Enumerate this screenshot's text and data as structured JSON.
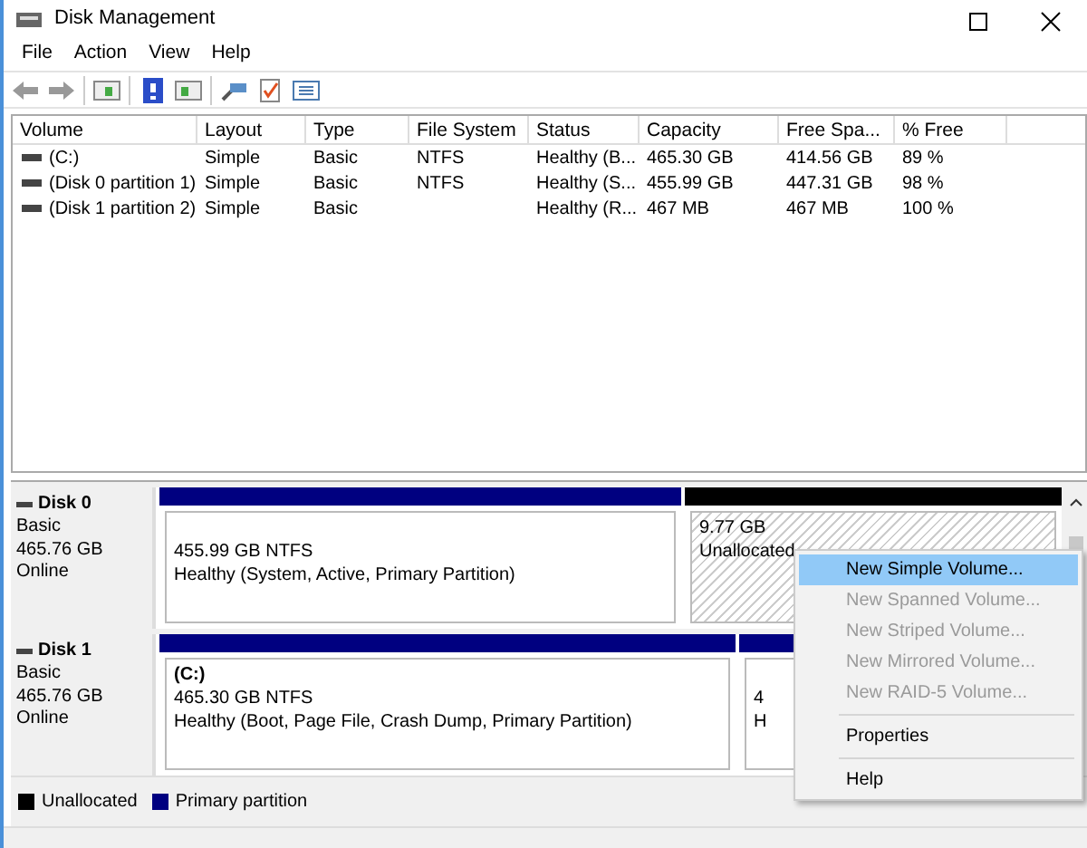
{
  "window": {
    "title": "Disk Management"
  },
  "menu": [
    "File",
    "Action",
    "View",
    "Help"
  ],
  "table": {
    "columns": [
      "Volume",
      "Layout",
      "Type",
      "File System",
      "Status",
      "Capacity",
      "Free Spa...",
      "% Free"
    ],
    "rows": [
      {
        "cells": [
          "(C:)",
          "Simple",
          "Basic",
          "NTFS",
          "Healthy (B...",
          "465.30 GB",
          "414.56 GB",
          "89 %"
        ]
      },
      {
        "cells": [
          "(Disk 0 partition 1)",
          "Simple",
          "Basic",
          "NTFS",
          "Healthy (S...",
          "455.99 GB",
          "447.31 GB",
          "98 %"
        ]
      },
      {
        "cells": [
          "(Disk 1 partition 2)",
          "Simple",
          "Basic",
          "",
          "Healthy (R...",
          "467 MB",
          "467 MB",
          "100 %"
        ]
      }
    ]
  },
  "disks": [
    {
      "name": "Disk 0",
      "type": "Basic",
      "size": "465.76 GB",
      "state": "Online",
      "partitions": [
        {
          "kind": "primary",
          "lines": [
            "455.99 GB NTFS",
            "Healthy (System, Active, Primary Partition)"
          ]
        },
        {
          "kind": "unallocated",
          "lines": [
            "9.77 GB",
            "Unallocated"
          ]
        }
      ]
    },
    {
      "name": "Disk 1",
      "type": "Basic",
      "size": "465.76 GB",
      "state": "Online",
      "partitions": [
        {
          "kind": "primary",
          "title": "(C:)",
          "lines": [
            "465.30 GB NTFS",
            "Healthy (Boot, Page File, Crash Dump, Primary Partition)"
          ]
        },
        {
          "kind": "primary",
          "lines": [
            "4",
            "H"
          ]
        }
      ]
    }
  ],
  "legend": [
    {
      "label": "Unallocated",
      "color": "#000000"
    },
    {
      "label": "Primary partition",
      "color": "#000080"
    }
  ],
  "context_menu": [
    {
      "label": "New Simple Volume...",
      "selected": true,
      "disabled": false
    },
    {
      "label": "New Spanned Volume...",
      "selected": false,
      "disabled": true
    },
    {
      "label": "New Striped Volume...",
      "selected": false,
      "disabled": true
    },
    {
      "label": "New Mirrored Volume...",
      "selected": false,
      "disabled": true
    },
    {
      "label": "New RAID-5 Volume...",
      "selected": false,
      "disabled": true,
      "separator_after": true
    },
    {
      "label": "Properties",
      "selected": false,
      "disabled": false,
      "separator_after": true
    },
    {
      "label": "Help",
      "selected": false,
      "disabled": false
    }
  ]
}
